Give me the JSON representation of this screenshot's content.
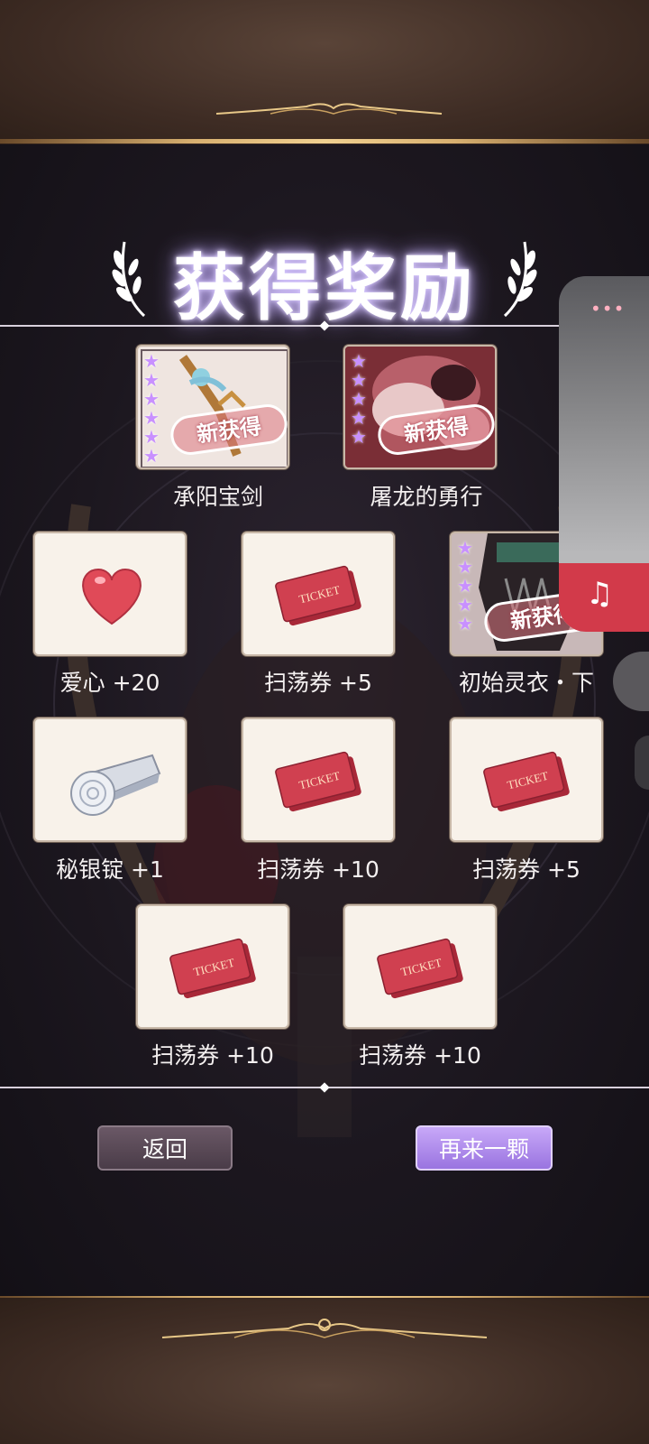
{
  "title": "获得奖励",
  "new_badge_text": "新获得",
  "rewards": [
    {
      "label": "承阳宝剑",
      "type": "art",
      "stars": 6,
      "new": true,
      "icon": "sword-icon"
    },
    {
      "label": "屠龙的勇行",
      "type": "art",
      "stars": 5,
      "new": true,
      "icon": "illustration-icon"
    },
    {
      "label": "爱心 +20",
      "type": "item",
      "icon": "heart-icon"
    },
    {
      "label": "扫荡券 +5",
      "type": "item",
      "icon": "ticket-icon"
    },
    {
      "label": "初始灵衣・下",
      "type": "art",
      "stars": 5,
      "new": true,
      "icon": "costume-icon"
    },
    {
      "label": "秘银锭 +1",
      "type": "item",
      "icon": "ingot-icon"
    },
    {
      "label": "扫荡券 +10",
      "type": "item",
      "icon": "ticket-icon"
    },
    {
      "label": "扫荡券 +5",
      "type": "item",
      "icon": "ticket-icon"
    },
    {
      "label": "扫荡券 +10",
      "type": "item",
      "icon": "ticket-icon"
    },
    {
      "label": "扫荡券 +10",
      "type": "item",
      "icon": "ticket-icon"
    }
  ],
  "ticket_text": "TICKET",
  "buttons": {
    "back": "返回",
    "again": "再来一颗"
  },
  "side_widget": {
    "menu_icon": "more-dots-icon",
    "music_icon": "music-note-icon"
  },
  "colors": {
    "accent": "#a880f0",
    "star": "#c890ff",
    "ticket": "#d04050",
    "gold": "#d8b070"
  }
}
